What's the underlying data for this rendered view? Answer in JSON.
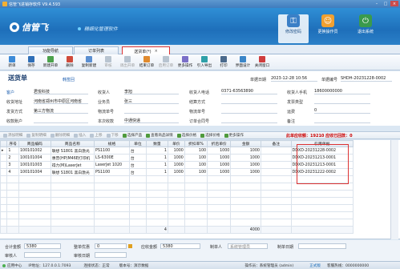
{
  "window": {
    "title": "信管飞进销存软件 V9.4.593"
  },
  "banner": {
    "logo": "信管飞",
    "slogan": "精细化管理软件",
    "buttons": [
      {
        "label": "修改密码",
        "icon": "key-icon"
      },
      {
        "label": "更换操作员",
        "icon": "user-switch-icon"
      },
      {
        "label": "退出系统",
        "icon": "exit-icon"
      }
    ]
  },
  "tabs": [
    {
      "label": "功能导航"
    },
    {
      "label": "订单列表"
    },
    {
      "label": "送货单(*)",
      "active": true
    }
  ],
  "toolbar": [
    {
      "label": "新单",
      "icon": "new-doc-icon"
    },
    {
      "label": "保存",
      "icon": "save-icon"
    },
    {
      "label": "新建开单",
      "icon": "new-order-icon"
    },
    {
      "label": "删除",
      "icon": "delete-icon"
    },
    {
      "label": "复制新建",
      "icon": "copy-new-icon"
    },
    {
      "label": "审核",
      "icon": "approve-icon",
      "disabled": true
    },
    {
      "label": "调出开单",
      "icon": "import-order-icon",
      "disabled": true
    },
    {
      "label": "结束订单",
      "icon": "end-order-icon"
    },
    {
      "label": "启用订单",
      "icon": "enable-order-icon",
      "disabled": true
    },
    {
      "label": "更多操作",
      "icon": "more-ops-icon"
    },
    {
      "label": "引入导出",
      "icon": "import-export-icon"
    },
    {
      "label": "打印",
      "icon": "print-icon"
    },
    {
      "label": "界面设计",
      "icon": "design-icon"
    },
    {
      "label": "关闭窗口",
      "icon": "close-window-icon"
    }
  ],
  "doc": {
    "title": "送货单",
    "subtitle": "韩签回",
    "date_label": "单据日期",
    "date_value": "2023-12-28 10:56",
    "number_label": "单据编号",
    "number_value": "SHDH-20231228-0002",
    "fields_row1": [
      {
        "label": "客户",
        "value": "君悦科技"
      },
      {
        "label": "收货人",
        "value": "李旭"
      },
      {
        "label": "收货人电话",
        "value": "0371-63563890"
      },
      {
        "label": "收货人手机",
        "value": "18600000000"
      }
    ],
    "fields_row2": [
      {
        "label": "收货地址",
        "value": "河南省郑州市中原区河南省"
      },
      {
        "label": "业务员",
        "value": "张三"
      },
      {
        "label": "结算方式",
        "value": ""
      },
      {
        "label": "发票类型",
        "value": ""
      }
    ],
    "fields_row3": [
      {
        "label": "发货方式",
        "value": "第三方物流"
      },
      {
        "label": "物流单号",
        "value": ""
      },
      {
        "label": "物流单号",
        "value": ""
      },
      {
        "label": "运费",
        "value": "0"
      }
    ],
    "fields_row4": [
      {
        "label": "收款账户",
        "value": ""
      },
      {
        "label": "本次收款",
        "value": "中通快递"
      },
      {
        "label": "订单合同号",
        "value": ""
      },
      {
        "label": "备注",
        "value": ""
      }
    ]
  },
  "gridbar": {
    "buttons": [
      {
        "label": "添加明细",
        "on": false
      },
      {
        "label": "复制明细",
        "on": false
      },
      {
        "label": "删除明细",
        "on": false
      },
      {
        "label": "插入",
        "on": false
      },
      {
        "label": "上移",
        "on": false
      },
      {
        "label": "下移",
        "on": false
      },
      {
        "label": "选择产品",
        "on": true
      },
      {
        "label": "查看商品详情",
        "on": true
      },
      {
        "label": "选择价格",
        "on": true
      },
      {
        "label": "选择价格",
        "on": true
      },
      {
        "label": "更多操作",
        "on": true
      }
    ],
    "note": "此单应收额：19210    应收已回款：0"
  },
  "grid": {
    "columns": [
      "序号",
      "商品编码",
      "商品名称",
      "规格",
      "单位",
      "数量",
      "单价",
      "折扣率%",
      "折后单价",
      "金额",
      "备注",
      "引用单据"
    ],
    "rows": [
      [
        "1",
        "100101002",
        "联想 S1801 黑白激光",
        "PS1100",
        "台",
        "1",
        "1000",
        "100",
        "1000",
        "1000",
        "",
        "DDXD-20231228-0002"
      ],
      [
        "2",
        "100101004",
        "惠普(HP)M46E打印机",
        "LS-6300E",
        "台",
        "1",
        "1000",
        "100",
        "1000",
        "1000",
        "",
        "DDXD-20231213-0001"
      ],
      [
        "3",
        "100101003",
        "得力(M)LaserJet",
        "LaserJet 1020",
        "台",
        "1",
        "1000",
        "100",
        "1000",
        "1000",
        "",
        "DDXD-20231213-0001"
      ],
      [
        "4",
        "100101004",
        "联想 S1801 黑白激光",
        "PS1100",
        "台",
        "1",
        "1000",
        "100",
        "1000",
        "1000",
        "",
        "DDXD-20231222-0002"
      ]
    ],
    "total": [
      "4",
      "4000"
    ]
  },
  "footer": {
    "row1": [
      {
        "label": "合计金额",
        "value": "5380"
      },
      {
        "label": "整单优惠",
        "value": "0"
      },
      {
        "label": "应收金额",
        "value": "5380"
      },
      {
        "label": "制单人",
        "value": "系统管理员"
      },
      {
        "label": "制单日期",
        "value": ""
      }
    ],
    "row2": [
      {
        "label": "审核人",
        "value": ""
      },
      {
        "label": "审核日期",
        "value": ""
      }
    ]
  },
  "status": {
    "left": "应用中心",
    "ip": "IP地址：127.0.0.1:7093",
    "conn": "连接状态：正常",
    "version": "版本号：演示数据",
    "operator": "操作员：系统管理员 (admin)",
    "mode": "正式版",
    "phone": "客服热线：0000000000"
  }
}
